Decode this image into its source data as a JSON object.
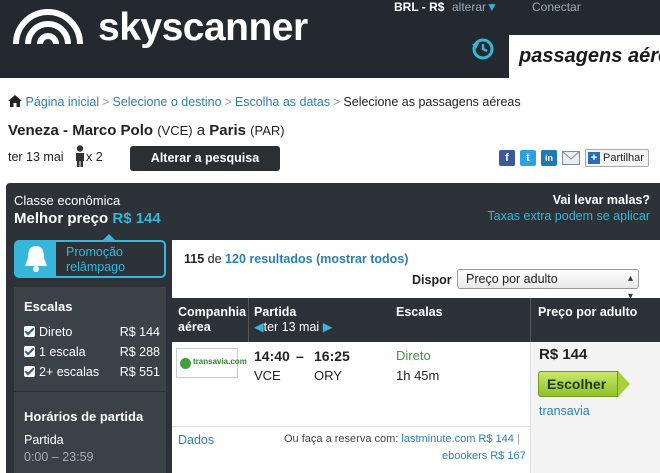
{
  "header": {
    "brand": "skyscanner",
    "currency": "BRL - R$",
    "change": "alterar",
    "login": "Conectar",
    "search_tab": "passagens aére"
  },
  "breadcrumb": [
    "Página inicial",
    "Selecione o destino",
    "Escolha as datas",
    "Selecione as passagens aéreas"
  ],
  "route": {
    "origin": "Veneza - Marco Polo",
    "origin_code": "(VCE)",
    "connector": "a",
    "destination": "Paris",
    "destination_code": "(PAR)"
  },
  "search": {
    "date": "ter 13 mai",
    "passengers": "x 2",
    "alter_button": "Alterar a pesquisa",
    "share_button": "Partilhar"
  },
  "summary": {
    "class": "Classe econômica",
    "best_price_label": "Melhor preço",
    "best_price": "R$ 144",
    "bags_question": "Vai levar malas?",
    "extra_fees": "Taxas extra podem se aplicar"
  },
  "promo": {
    "line1": "Promoção",
    "line2": "relâmpago"
  },
  "filters": {
    "stops_title": "Escalas",
    "stops": [
      {
        "label": "Direto",
        "price": "R$ 144",
        "checked": true
      },
      {
        "label": "1 escala",
        "price": "R$ 288",
        "checked": true
      },
      {
        "label": "2+ escalas",
        "price": "R$ 551",
        "checked": true
      }
    ],
    "departure_title": "Horários de partida",
    "departure_sub": "Partida",
    "departure_range": "0:00 – 23:59"
  },
  "results": {
    "shown": "115",
    "of": "de",
    "total_text": "120 resultados (mostrar todos)",
    "sort_label": "Dispor",
    "sort_value": "Preço por adulto"
  },
  "table": {
    "col_airline_1": "Companhia",
    "col_airline_2": "aérea",
    "col_departure": "Partida",
    "col_date": "ter 13 mai",
    "col_stops": "Escalas",
    "col_price": "Preço por adulto"
  },
  "flight": {
    "airline_logo_text": "transavia.com",
    "depart_time": "14:40",
    "dash": "–",
    "arrive_time": "16:25",
    "from": "VCE",
    "to": "ORY",
    "stops": "Direto",
    "duration": "1h 45m",
    "price": "R$ 144",
    "select_button": "Escolher",
    "airline": "transavia",
    "details": "Dados",
    "book_text": "Ou faça a reserva com:",
    "partner1": "lastminute.com R$ 144",
    "partner_sep": "|",
    "partner2": "ebookers R$ 167"
  },
  "colors": {
    "accent": "#35b6da",
    "header_bg": "#23292f",
    "panel_bg": "#2c3237",
    "select_green": "#8fc12a"
  }
}
